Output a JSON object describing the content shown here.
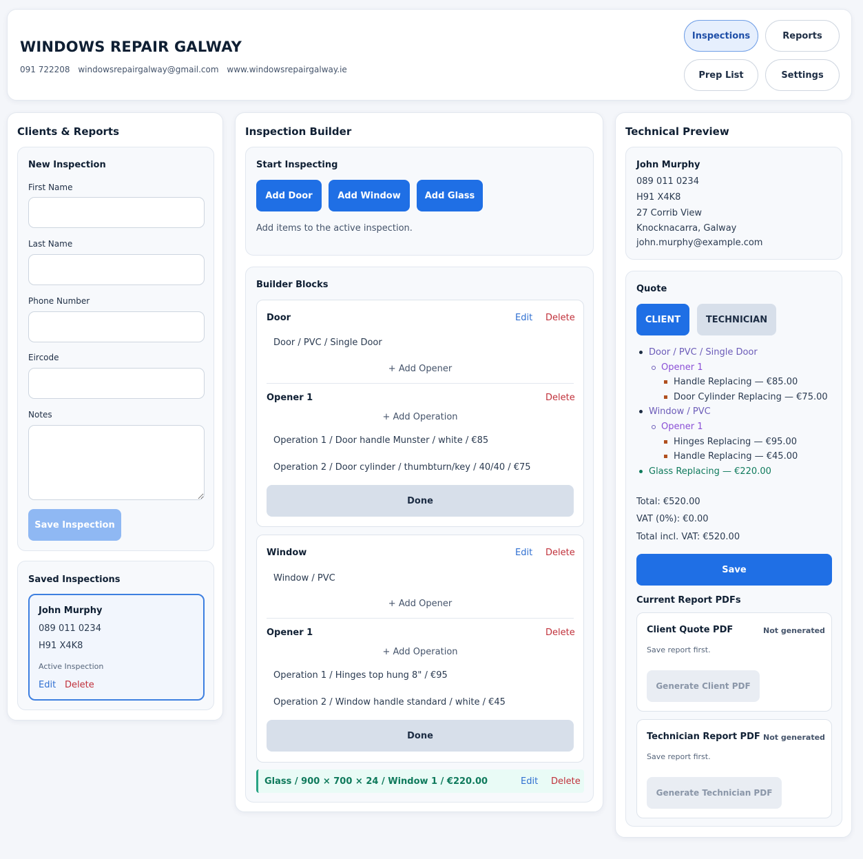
{
  "header": {
    "brand": "WINDOWS REPAIR GALWAY",
    "phone": "091 722208",
    "email": "windowsrepairgalway@gmail.com",
    "website": "www.windowsrepairgalway.ie",
    "nav": [
      "Inspections",
      "Reports",
      "Prep List",
      "Settings"
    ],
    "active_nav": "Inspections"
  },
  "clients": {
    "title": "Clients & Reports",
    "new_inspection": {
      "title": "New Inspection",
      "first_name_label": "First Name",
      "last_name_label": "Last Name",
      "phone_label": "Phone Number",
      "eircode_label": "Eircode",
      "notes_label": "Notes",
      "save_label": "Save Inspection"
    },
    "saved": {
      "title": "Saved Inspections",
      "name": "John Murphy",
      "phone": "089 011 0234",
      "eircode": "H91 X4K8",
      "status": "Active Inspection",
      "edit": "Edit",
      "delete": "Delete"
    }
  },
  "builder": {
    "title": "Inspection Builder",
    "start": {
      "title": "Start Inspecting",
      "buttons": [
        "Add Door",
        "Add Window",
        "Add Glass"
      ],
      "hint": "Add items to the active inspection."
    },
    "blocks_title": "Builder Blocks",
    "door": {
      "title": "Door",
      "edit": "Edit",
      "delete": "Delete",
      "summary": "Door / PVC / Single Door",
      "add_opener": "+ Add Opener",
      "opener_title": "Opener 1",
      "opener_delete": "Delete",
      "add_operation": "+ Add Operation",
      "op1": "Operation 1 / Door handle Munster / white / €85",
      "op2": "Operation 2 / Door cylinder / thumbturn/key / 40/40 / €75",
      "done": "Done"
    },
    "window": {
      "title": "Window",
      "edit": "Edit",
      "delete": "Delete",
      "summary": "Window / PVC",
      "add_opener": "+ Add Opener",
      "opener_title": "Opener 1",
      "opener_delete": "Delete",
      "add_operation": "+ Add Operation",
      "op1": "Operation 1 / Hinges top hung 8\" / €95",
      "op2": "Operation 2 / Window handle standard / white / €45",
      "done": "Done"
    },
    "glass": {
      "text": "Glass / 900 × 700 × 24 / Window 1 / €220.00",
      "edit": "Edit",
      "delete": "Delete"
    }
  },
  "preview": {
    "title": "Technical Preview",
    "client": {
      "name": "John Murphy",
      "phone": "089 011 0234",
      "eircode": "H91 X4K8",
      "address1": "27 Corrib View",
      "address2": "Knocknacarra, Galway",
      "email": "john.murphy@example.com"
    },
    "quote": {
      "title": "Quote",
      "tab_client": "CLIENT",
      "tab_technician": "TECHNICIAN",
      "items": {
        "door": "Door / PVC / Single Door",
        "door_opener": "Opener 1",
        "door_op1": "Handle Replacing — €85.00",
        "door_op2": "Door Cylinder Replacing — €75.00",
        "window": "Window / PVC",
        "window_opener": "Opener 1",
        "window_op1": "Hinges Replacing — €95.00",
        "window_op2": "Handle Replacing — €45.00",
        "glass": "Glass Replacing — €220.00"
      },
      "total": "Total: €520.00",
      "vat": "VAT (0%): €0.00",
      "total_incl": "Total incl. VAT: €520.00",
      "save": "Save"
    },
    "pdfs": {
      "title": "Current Report PDFs",
      "client": {
        "title": "Client Quote PDF",
        "status": "Not generated",
        "hint": "Save report first.",
        "button": "Generate Client PDF"
      },
      "technician": {
        "title": "Technician Report PDF",
        "status": "Not generated",
        "hint": "Save report first.",
        "button": "Generate Technician PDF"
      }
    }
  },
  "colors": {
    "accent": "#1f6fe5",
    "danger": "#c0303a",
    "link": "#2f6fd1",
    "quote_item": "#6b5bb8",
    "quote_op_marker": "#b0501f",
    "glass": "#0f7a5c",
    "glass_bg": "#e9fbf6"
  }
}
